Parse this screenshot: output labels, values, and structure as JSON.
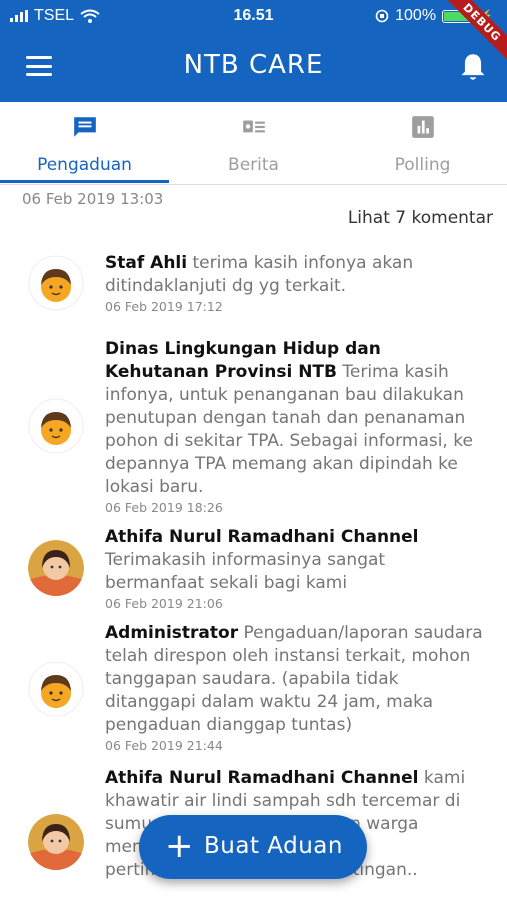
{
  "status_bar": {
    "carrier": "TSEL",
    "time": "16.51",
    "battery": "100%",
    "debug_banner": "DEBUG"
  },
  "app_bar": {
    "title": "NTB CARE",
    "menu_icon": "menu-icon",
    "bell_icon": "bell-icon"
  },
  "tabs": [
    {
      "label": "Pengaduan",
      "icon": "chat-icon",
      "active": true
    },
    {
      "label": "Berita",
      "icon": "news-icon",
      "active": false
    },
    {
      "label": "Polling",
      "icon": "poll-icon",
      "active": false
    }
  ],
  "post": {
    "date": "06 Feb 2019 13:03",
    "see_comments": "Lihat 7 komentar"
  },
  "comments": [
    {
      "author": "Staf Ahli",
      "text": "terima kasih infonya akan ditindaklanjuti dg yg terkait.",
      "date": "06 Feb 2019 17:12"
    },
    {
      "author": "Dinas Lingkungan Hidup dan Kehutanan Provinsi NTB",
      "text": "Terima kasih infonya, untuk penanganan bau dilakukan penutupan dengan tanah dan penanaman pohon di sekitar TPA. Sebagai informasi, ke depannya TPA memang akan dipindah ke lokasi baru.",
      "date": "06 Feb 2019 18:26"
    },
    {
      "author": "Athifa Nurul Ramadhani Channel",
      "text": "Terimakasih informasinya sangat bermanfaat sekali bagi kami",
      "date": "06 Feb 2019 21:06"
    },
    {
      "author": "Administrator",
      "text": "Pengaduan/laporan saudara telah direspon oleh instansi terkait, mohon tanggapan saudara. (apabila tidak ditanggapi dalam waktu 24 jam, maka pengaduan dianggap tuntas)",
      "date": "06 Feb 2019 21:44"
    },
    {
      "author": "Athifa Nurul Ramadhani Channel",
      "text": "kami khawatir air lindi sampah sdh tercemar di sumur warga... mohon persen warga mempertimbangkan... mohon pertimbangan... untuk kepentingan..",
      "date": ""
    }
  ],
  "fab": {
    "label": "Buat Aduan"
  },
  "colors": {
    "primary": "#1565c0",
    "author": "#111111",
    "body_text": "#757575"
  }
}
